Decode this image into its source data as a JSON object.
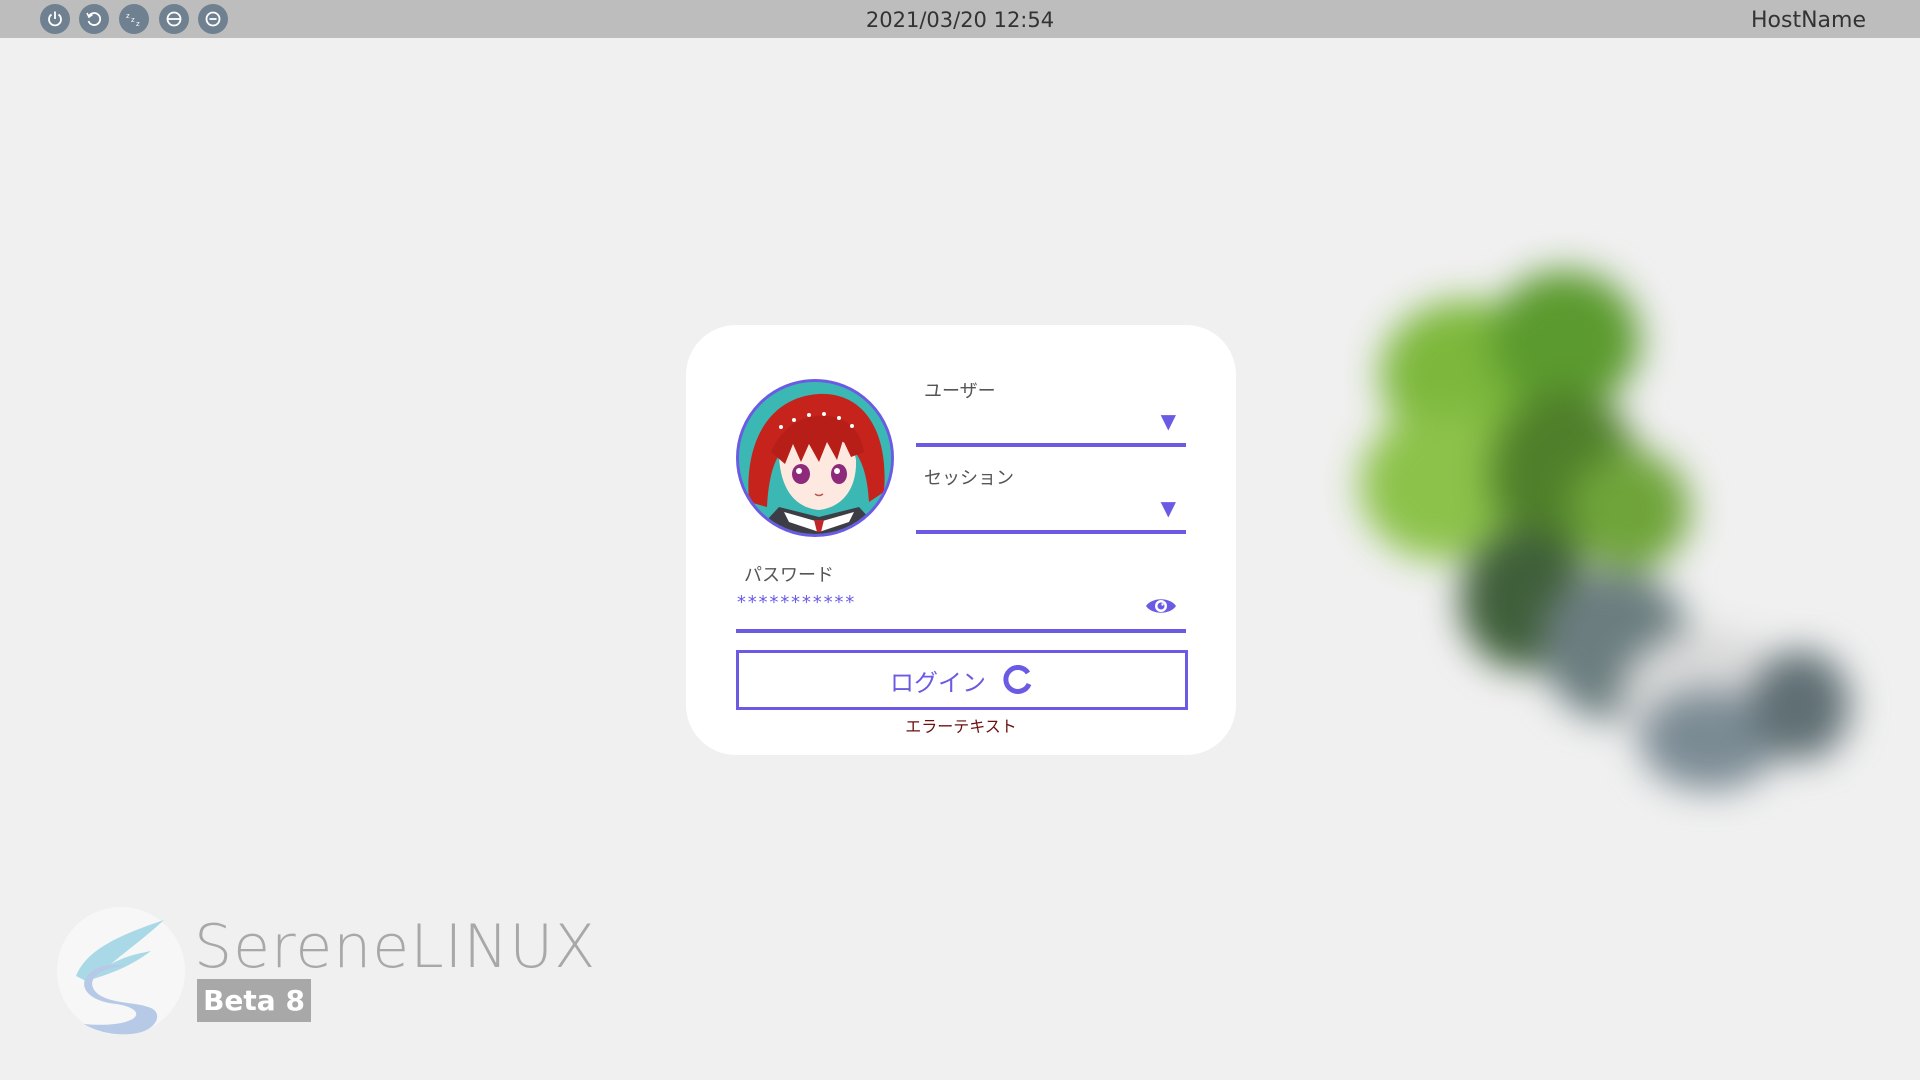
{
  "topbar": {
    "buttons": [
      {
        "name": "power-icon"
      },
      {
        "name": "reboot-icon"
      },
      {
        "name": "suspend-icon"
      },
      {
        "name": "hibernate-icon"
      },
      {
        "name": "hybrid-sleep-icon"
      }
    ],
    "clock": "2021/03/20 12:54",
    "hostname": "HostName"
  },
  "login": {
    "user_label": "ユーザー",
    "user_value": "",
    "session_label": "セッション",
    "session_value": "",
    "password_label": "パスワード",
    "password_value": "***********",
    "login_button_label": "ログイン",
    "error_text": "エラーテキスト"
  },
  "logo": {
    "name": "SereneLINUX",
    "badge": "Beta 8"
  },
  "colors": {
    "accent": "#6b5be4",
    "background": "#f0f0f0",
    "topbar": "#bdbdbd",
    "error": "#6b0f0f"
  }
}
